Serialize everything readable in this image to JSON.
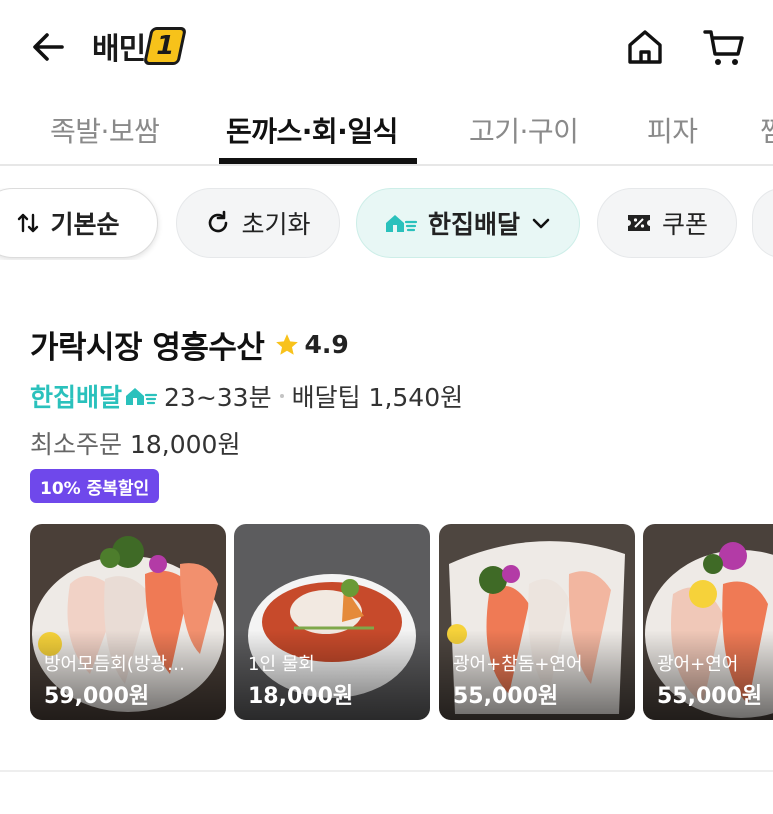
{
  "header": {
    "logo_text": "배민",
    "logo_number": "1",
    "back_icon": "arrow-left-icon",
    "home_icon": "home-icon",
    "cart_icon": "cart-icon"
  },
  "tabs": [
    {
      "label": "족발·보쌈",
      "active": false
    },
    {
      "label": "돈까스·회·일식",
      "active": true
    },
    {
      "label": "고기·구이",
      "active": false
    },
    {
      "label": "피자",
      "active": false
    },
    {
      "label": "찜",
      "active": false
    }
  ],
  "filters": {
    "sort_label": "기본순",
    "reset_label": "초기화",
    "hanjip_label": "한집배달",
    "coupon_label": "쿠폰"
  },
  "store": {
    "name": "가락시장 영흥수산",
    "rating": "4.9",
    "delivery_type": "한집배달",
    "delivery_time": "23~33분",
    "delivery_tip": "배달팁 1,540원",
    "min_order_label": "최소주문",
    "min_order_value": "18,000원",
    "badge": "10% 중복할인"
  },
  "menus": [
    {
      "name": "방어모듬회(방광…",
      "price": "59,000원"
    },
    {
      "name": "1인 물회",
      "price": "18,000원"
    },
    {
      "name": "광어+참돔+연어",
      "price": "55,000원"
    },
    {
      "name": "광어+연어",
      "price": "55,000원"
    }
  ],
  "colors": {
    "brand_teal": "#2ac1bc",
    "badge_purple": "#6f48eb",
    "star_yellow": "#f8c21b"
  }
}
